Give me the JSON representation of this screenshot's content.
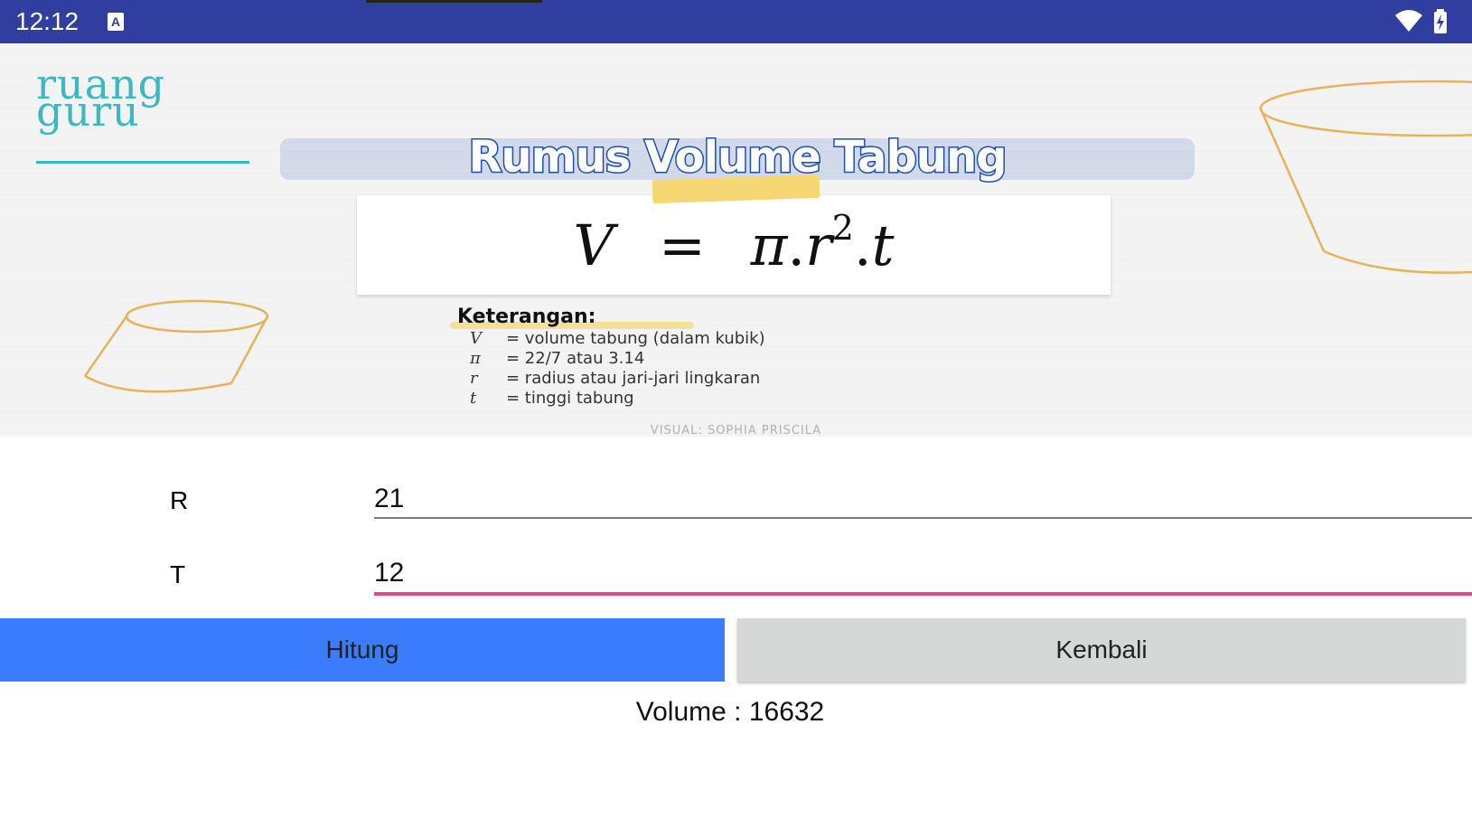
{
  "status_bar": {
    "time": "12:12",
    "notification_icon": "a-icon",
    "wifi_icon": "wifi-icon",
    "battery_icon": "battery-charging-icon"
  },
  "banner": {
    "logo_line1": "ruang",
    "logo_line2": "guru",
    "title": "Rumus Volume Tabung",
    "formula_v": "V",
    "formula_eq": "=",
    "formula_pi": "π",
    "formula_dot": ".",
    "formula_r": "r",
    "formula_exp": "2",
    "formula_t": "t",
    "keterangan_title": "Keterangan:",
    "keterangan": [
      {
        "symbol": "V",
        "text": "= volume tabung (dalam kubik)"
      },
      {
        "symbol": "π",
        "text": "= 22/7 atau 3.14"
      },
      {
        "symbol": "r",
        "text": "= radius atau jari-jari lingkaran"
      },
      {
        "symbol": "t",
        "text": "= tinggi tabung"
      }
    ],
    "credit": "VISUAL: SOPHIA PRISCILA"
  },
  "form": {
    "r_label": "R",
    "r_value": "21",
    "t_label": "T",
    "t_value": "12"
  },
  "buttons": {
    "hitung": "Hitung",
    "kembali": "Kembali"
  },
  "result": {
    "text": "Volume : 16632"
  },
  "colors": {
    "status_bar": "#303f9f",
    "primary_button": "#3a7cfc",
    "secondary_button": "#d6d7d7",
    "focus_underline": "#e84a84",
    "brand_teal": "#3bb9c0",
    "title_blue": "#1b4fb3",
    "highlight_yellow": "#f5d773"
  }
}
